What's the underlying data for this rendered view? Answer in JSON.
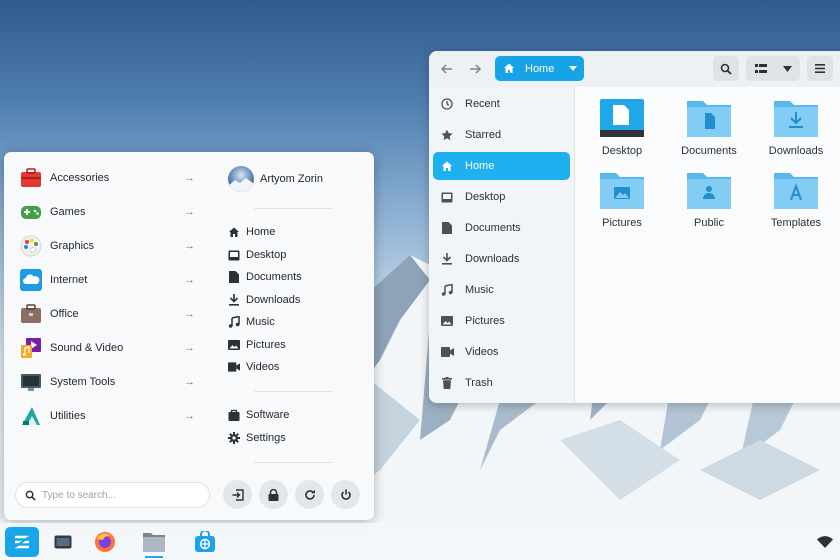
{
  "file_manager": {
    "header": {
      "back_icon": "arrow-left-icon",
      "forward_icon": "arrow-right-icon",
      "path_label": "Home",
      "search_icon": "search-icon",
      "view_icon": "list-view-icon",
      "view_dropdown_icon": "chevron-down-icon",
      "menu_icon": "hamburger-icon"
    },
    "sidebar": [
      {
        "label": "Recent",
        "icon": "clock-icon"
      },
      {
        "label": "Starred",
        "icon": "star-icon"
      },
      {
        "label": "Home",
        "icon": "home-icon",
        "active": true
      },
      {
        "label": "Desktop",
        "icon": "desktop-icon"
      },
      {
        "label": "Documents",
        "icon": "document-icon"
      },
      {
        "label": "Downloads",
        "icon": "download-icon"
      },
      {
        "label": "Music",
        "icon": "music-icon"
      },
      {
        "label": "Pictures",
        "icon": "picture-icon"
      },
      {
        "label": "Videos",
        "icon": "video-icon"
      },
      {
        "label": "Trash",
        "icon": "trash-icon"
      }
    ],
    "folders": [
      {
        "name": "Desktop",
        "icon": "desktop-folder-icon"
      },
      {
        "name": "Documents",
        "icon": "documents-folder-icon"
      },
      {
        "name": "Downloads",
        "icon": "downloads-folder-icon"
      },
      {
        "name": "Pictures",
        "icon": "pictures-folder-icon"
      },
      {
        "name": "Public",
        "icon": "public-folder-icon"
      },
      {
        "name": "Templates",
        "icon": "templates-folder-icon"
      }
    ]
  },
  "start_menu": {
    "categories": [
      {
        "label": "Accessories",
        "icon": "toolbox-icon"
      },
      {
        "label": "Games",
        "icon": "gamepad-icon"
      },
      {
        "label": "Graphics",
        "icon": "palette-icon"
      },
      {
        "label": "Internet",
        "icon": "cloud-icon"
      },
      {
        "label": "Office",
        "icon": "briefcase-icon"
      },
      {
        "label": "Sound & Video",
        "icon": "media-icon"
      },
      {
        "label": "System Tools",
        "icon": "monitor-icon"
      },
      {
        "label": "Utilities",
        "icon": "utilities-icon"
      }
    ],
    "arrow": "→",
    "user_name": "Artyom Zorin",
    "places": [
      {
        "label": "Home",
        "icon": "home-icon"
      },
      {
        "label": "Desktop",
        "icon": "desktop-icon"
      },
      {
        "label": "Documents",
        "icon": "document-icon"
      },
      {
        "label": "Downloads",
        "icon": "download-icon"
      },
      {
        "label": "Music",
        "icon": "music-icon"
      },
      {
        "label": "Pictures",
        "icon": "picture-icon"
      },
      {
        "label": "Videos",
        "icon": "video-icon"
      }
    ],
    "system": [
      {
        "label": "Software",
        "icon": "software-bag-icon"
      },
      {
        "label": "Settings",
        "icon": "gear-icon"
      }
    ],
    "search_placeholder": "Type to search...",
    "power_buttons": [
      "logout-icon",
      "lock-icon",
      "restart-icon",
      "power-icon"
    ]
  },
  "taskbar": {
    "items": [
      "zorin-menu-icon",
      "desktop-window-icon",
      "firefox-icon",
      "files-icon",
      "software-store-icon"
    ],
    "tray": [
      "wifi-icon"
    ]
  },
  "colors": {
    "accent": "#1fb0ef",
    "folder": "#7fcbf5",
    "folder_dark": "#1fa7e8"
  }
}
